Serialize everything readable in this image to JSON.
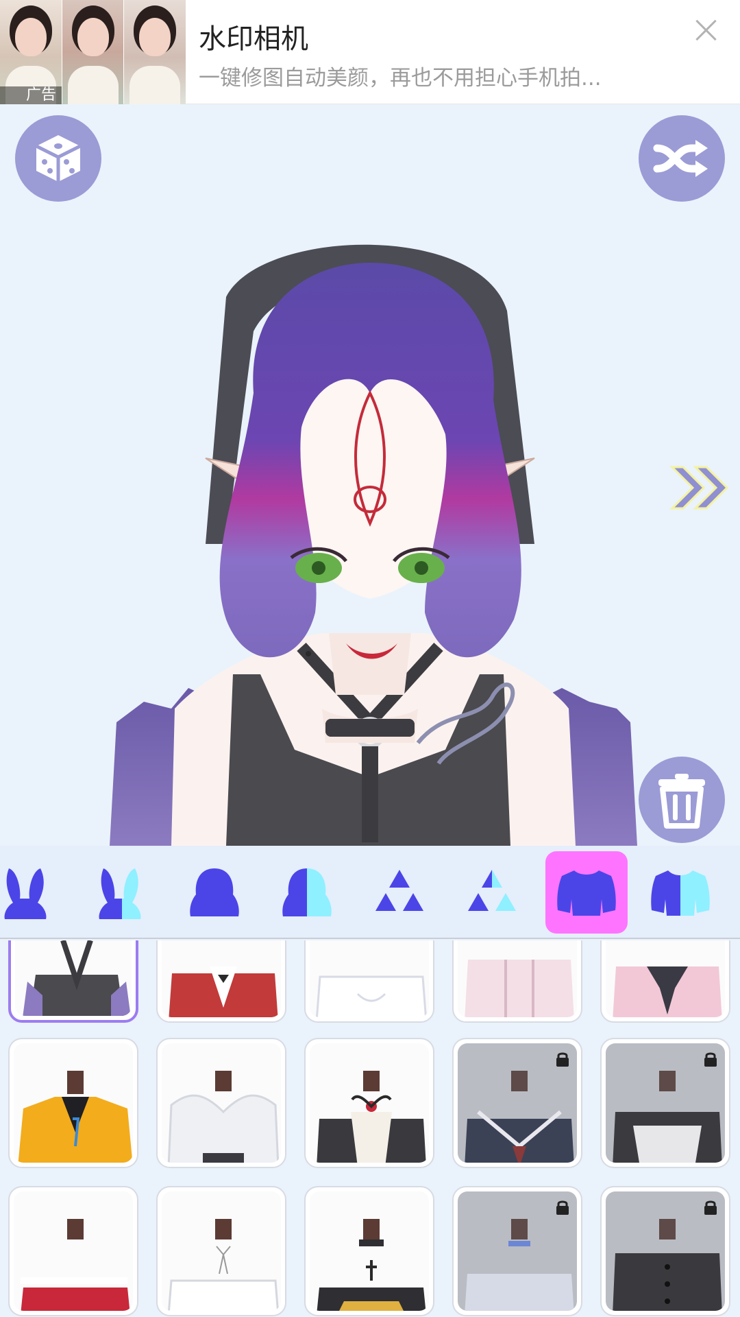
{
  "ad": {
    "title": "水印相机",
    "description": "一键修图自动美颜，再也不用担心手机拍...",
    "label": "广告"
  },
  "canvas": {
    "random_icon": "dice-icon",
    "shuffle_icon": "shuffle-icon",
    "next_icon": "double-chevron-right-icon",
    "delete_icon": "trash-icon"
  },
  "categories": [
    {
      "name": "ears-icon"
    },
    {
      "name": "ears-color-icon"
    },
    {
      "name": "hair-icon"
    },
    {
      "name": "hair-color-icon"
    },
    {
      "name": "accessory-icon"
    },
    {
      "name": "accessory-color-icon"
    },
    {
      "name": "top-icon",
      "active": true
    },
    {
      "name": "top-color-icon"
    }
  ],
  "colors": {
    "accent": "#9b9bd6",
    "category_active": "#ff74ff",
    "icon_blue": "#4b45e8",
    "icon_cyan": "#8ff0ff"
  },
  "items": [
    {
      "name": "outfit-halter-fur",
      "selected": true,
      "locked": false
    },
    {
      "name": "outfit-red-blazer",
      "selected": false,
      "locked": false
    },
    {
      "name": "outfit-white-puff",
      "selected": false,
      "locked": false
    },
    {
      "name": "outfit-pink-lace",
      "selected": false,
      "locked": false
    },
    {
      "name": "outfit-pink-ribbon",
      "selected": false,
      "locked": false
    },
    {
      "name": "outfit-yellow-hoodie",
      "selected": false,
      "locked": false
    },
    {
      "name": "outfit-white-fur",
      "selected": false,
      "locked": false
    },
    {
      "name": "outfit-corset-bow",
      "selected": false,
      "locked": false
    },
    {
      "name": "outfit-sailor",
      "selected": false,
      "locked": true
    },
    {
      "name": "outfit-maid-apron",
      "selected": false,
      "locked": true
    },
    {
      "name": "outfit-red-offshoulder",
      "selected": false,
      "locked": false
    },
    {
      "name": "outfit-white-ribbon",
      "selected": false,
      "locked": false
    },
    {
      "name": "outfit-black-cross",
      "selected": false,
      "locked": false
    },
    {
      "name": "outfit-white-choker",
      "selected": false,
      "locked": true
    },
    {
      "name": "outfit-black-buttoned",
      "selected": false,
      "locked": true
    }
  ]
}
